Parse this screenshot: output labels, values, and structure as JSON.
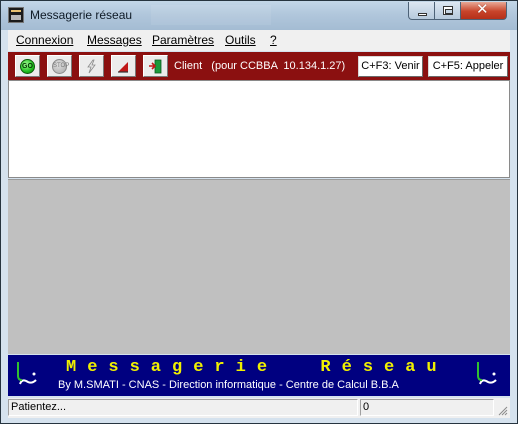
{
  "window": {
    "title": "Messagerie réseau"
  },
  "menu": [
    {
      "label": "Connexion"
    },
    {
      "label": "Messages"
    },
    {
      "label": "Paramètres"
    },
    {
      "label": "Outils"
    },
    {
      "label": "?"
    }
  ],
  "toolbar": {
    "icons": [
      "go-icon",
      "stop-icon",
      "lightning-icon",
      "triangle-icon",
      "exit-icon"
    ],
    "go_label": "GO",
    "stop_label": "STOP",
    "status": "Client   (pour CCBBA  10.134.1.27)",
    "venir_label": "C+F3: Venir",
    "appeler_label": "C+F5: Appeler",
    "bg_color": "#8b1010"
  },
  "banner": {
    "title": "Messagerie  Réseau",
    "subtitle": "By M.SMATI - CNAS - Direction informatique - Centre de Calcul B.B.A",
    "bg_color": "#000080",
    "title_color": "#f0f000"
  },
  "status": {
    "left": "Patientez...",
    "right": "0"
  }
}
